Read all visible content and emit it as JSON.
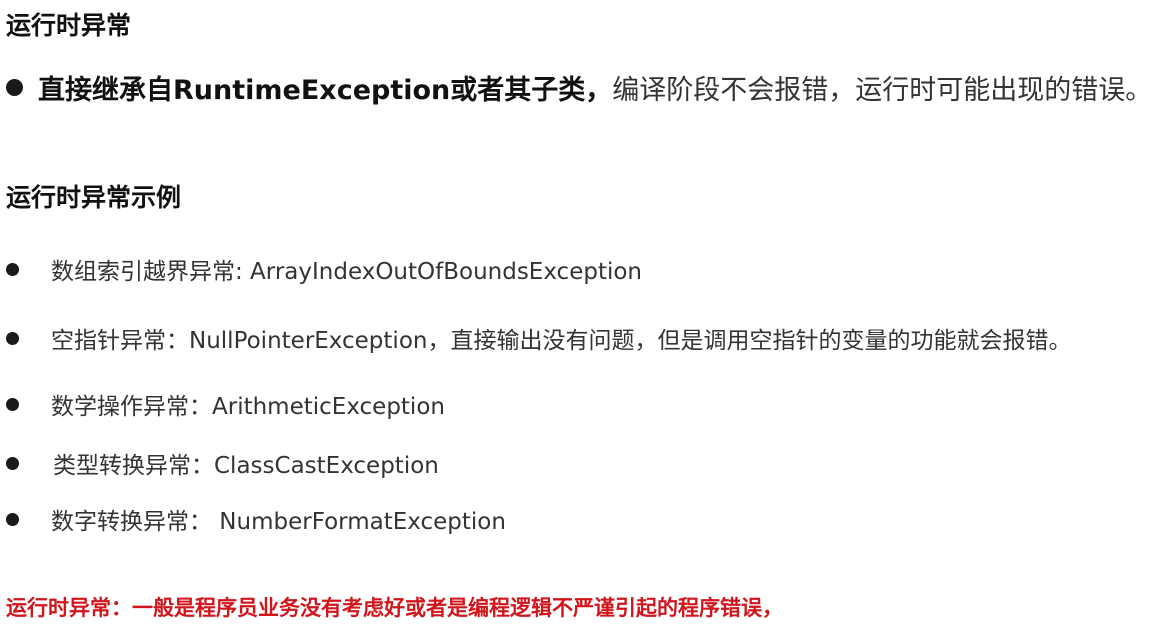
{
  "heading_main": "运行时异常",
  "intro": {
    "bold_text": "直接继承自RuntimeException或者其子类，",
    "normal_text": "编译阶段不会报错，运行时可能出现的错误。"
  },
  "heading_examples": "运行时异常示例",
  "examples": [
    {
      "text": "数组索引越界异常: ArrayIndexOutOfBoundsException"
    },
    {
      "text": "空指针异常：NullPointerException，直接输出没有问题，但是调用空指针的变量的功能就会报错。"
    },
    {
      "text": "数学操作异常：ArithmeticException"
    },
    {
      "text": "类型转换异常：ClassCastException"
    },
    {
      "text": "数字转换异常：  NumberFormatException"
    }
  ],
  "footer_note": "运行时异常：一般是程序员业务没有考虑好或者是编程逻辑不严谨引起的程序错误，",
  "colors": {
    "text": "#333333",
    "heading": "#111111",
    "footer_red": "#d0161c"
  }
}
